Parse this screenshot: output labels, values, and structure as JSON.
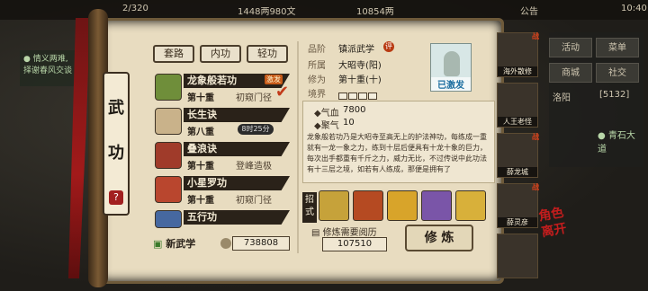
{
  "topbar": {
    "fraction": "2/320",
    "currency1": "1448两980文",
    "currency2": "10854两",
    "announce": "公告",
    "time": "10:40"
  },
  "left_quest": [
    "● 情义两难,",
    "择谢春风交谈"
  ],
  "right_panel": {
    "buttons": [
      "活动",
      "菜单",
      "商城",
      "社交"
    ],
    "location": "洛阳",
    "coords": "[5132]",
    "quest": "● 青石大道"
  },
  "scroll": {
    "title_chars": [
      "武",
      "功"
    ],
    "help": "?",
    "tabs": [
      "套路",
      "内功",
      "轻功"
    ]
  },
  "skills": [
    {
      "name": "龙象般若功",
      "level": "第十重",
      "rank": "初窥门径",
      "tag": "激发",
      "icon_color": "#6f8e3a"
    },
    {
      "name": "长生诀",
      "level": "第八重",
      "rank": "",
      "timer": "8时25分",
      "icon_color": "#c9b28a"
    },
    {
      "name": "叠浪诀",
      "level": "第十重",
      "rank": "登峰造极",
      "icon_color": "#a03b2a"
    },
    {
      "name": "小星罗功",
      "level": "第十重",
      "rank": "初窥门径",
      "icon_color": "#b9462e"
    },
    {
      "name": "五行功",
      "level": "",
      "rank": "",
      "icon_color": "#4668a0"
    }
  ],
  "new_skill": "新武学",
  "coins": "738808",
  "detail": {
    "grade_label": "品阶",
    "grade_value": "镇派武学",
    "grade_badge": "评",
    "sect_label": "所属",
    "sect_value": "大昭寺(阳)",
    "cultivate_label": "修为",
    "cultivate_value": "第十重(十)",
    "realm_label": "境界",
    "portrait_tag": "已激发",
    "stats": [
      {
        "label": "◆气血",
        "value": "7800"
      },
      {
        "label": "◆聚气",
        "value": "10"
      }
    ],
    "description": "龙象般若功乃是大昭寺至高无上的护法神功，每练成一重就有一龙一象之力，练到十层后便具有十龙十象的巨力，每次出手都重有千斤之力，威力无比，不过传说中此功法有十三层之境，如若有人练成，那便是拥有了",
    "moves_label": "招式",
    "moves": [
      "#c6a23a",
      "#b54a22",
      "#d8a42a",
      "#7a55a8",
      "#d8b03a"
    ],
    "req_label": "修炼需要阅历",
    "req_value": "107510",
    "train_button": "修 炼"
  },
  "characters": [
    {
      "name": "海外散修",
      "flag": "战"
    },
    {
      "name": "人王老怪",
      "flag": ""
    },
    {
      "name": "薛龙城",
      "flag": "战"
    },
    {
      "name": "薛灵彦",
      "flag": "战"
    },
    {
      "name": "",
      "flag": ""
    }
  ],
  "signature": "角色\n离开"
}
